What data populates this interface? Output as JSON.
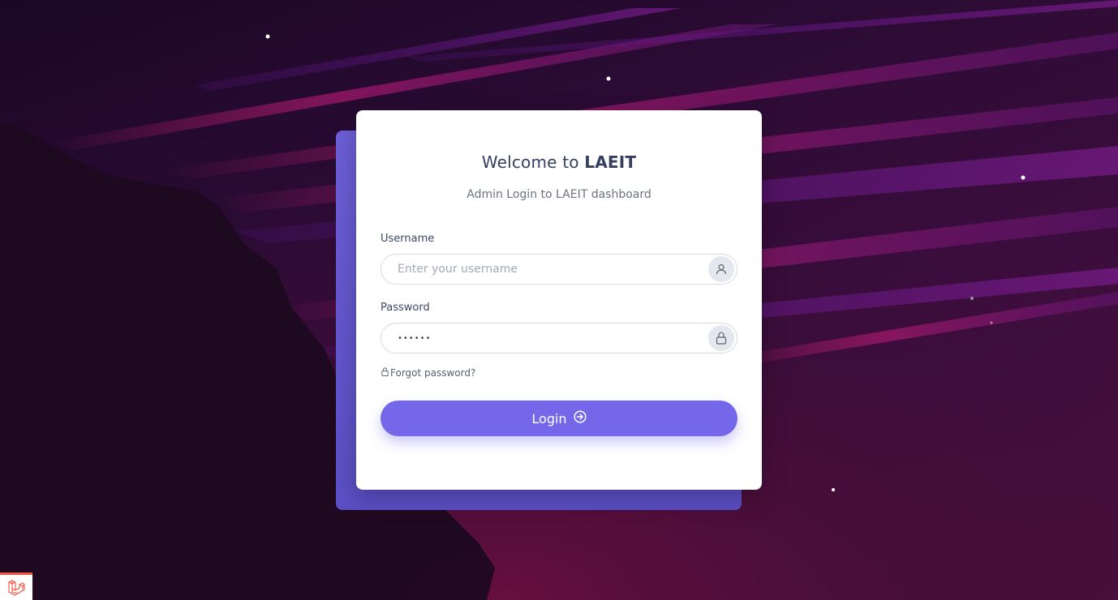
{
  "title": {
    "prefix": "Welcome to ",
    "brand": "LAEIT"
  },
  "subtitle": "Admin Login to LAEIT dashboard",
  "username": {
    "label": "Username",
    "placeholder": "Enter your username",
    "value": "",
    "icon": "user-icon"
  },
  "password": {
    "label": "Password",
    "value": "••••••",
    "icon": "lock-icon"
  },
  "forgot": {
    "label": "Forgot password?",
    "icon": "lock-small-icon"
  },
  "login_button": {
    "label": "Login",
    "icon": "arrow-circle-right-icon"
  },
  "corner_logo": {
    "icon": "laravel-logo-icon"
  },
  "colors": {
    "accent": "#7467ea",
    "back_card": "#5e52cb",
    "background": "#2a0b33",
    "streak": "#8a1a6a"
  }
}
